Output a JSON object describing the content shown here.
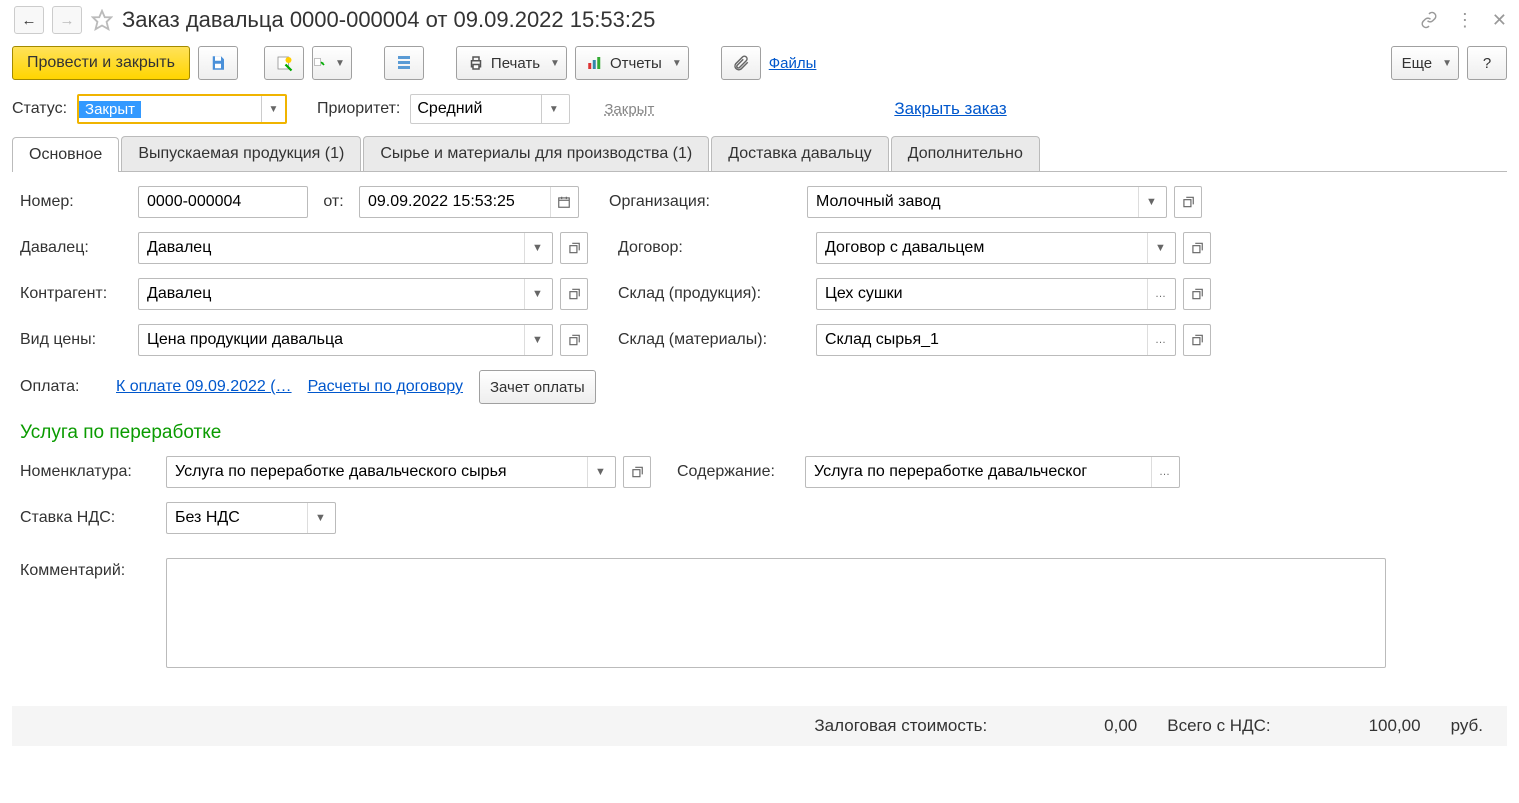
{
  "title": "Заказ давальца 0000-000004 от 09.09.2022 15:53:25",
  "toolbar": {
    "post_close": "Провести и закрыть",
    "print": "Печать",
    "reports": "Отчеты",
    "files": "Файлы",
    "more": "Еще",
    "help": "?"
  },
  "status_row": {
    "status_label": "Статус:",
    "status_value": "Закрыт",
    "priority_label": "Приоритет:",
    "priority_value": "Средний",
    "closed_hint": "Закрыт",
    "close_order": "Закрыть заказ"
  },
  "tabs": [
    {
      "label": "Основное"
    },
    {
      "label": "Выпускаемая продукция (1)"
    },
    {
      "label": "Сырье и материалы для производства (1)"
    },
    {
      "label": "Доставка давальцу"
    },
    {
      "label": "Дополнительно"
    }
  ],
  "form": {
    "number_label": "Номер:",
    "number": "0000-000004",
    "from_label": "от:",
    "date": "09.09.2022 15:53:25",
    "org_label": "Организация:",
    "org": "Молочный завод",
    "giver_label": "Давалец:",
    "giver": "Давалец",
    "contract_label": "Договор:",
    "contract": "Договор с давальцем",
    "counterparty_label": "Контрагент:",
    "counterparty": "Давалец",
    "warehouse_prod_label": "Склад (продукция):",
    "warehouse_prod": "Цех сушки",
    "price_type_label": "Вид цены:",
    "price_type": "Цена продукции давальца",
    "warehouse_mat_label": "Склад (материалы):",
    "warehouse_mat": "Склад сырья_1",
    "payment_label": "Оплата:",
    "payment_link": "К оплате 09.09.2022 (…",
    "settlements_link": "Расчеты по договору",
    "offset_btn": "Зачет оплаты",
    "service_section": "Услуга по переработке",
    "nomenclature_label": "Номенклатура:",
    "nomenclature": "Услуга по переработке давальческого сырья",
    "content_label": "Содержание:",
    "content": "Услуга по переработке давальческог",
    "vat_label": "Ставка НДС:",
    "vat": "Без НДС",
    "comment_label": "Комментарий:"
  },
  "totals": {
    "deposit_label": "Залоговая стоимость:",
    "deposit_value": "0,00",
    "total_vat_label": "Всего с НДС:",
    "total_vat_value": "100,00",
    "currency": "руб."
  }
}
